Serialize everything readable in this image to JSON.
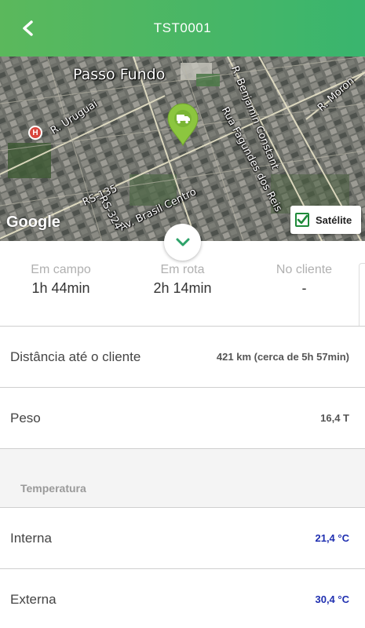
{
  "header": {
    "title": "TST0001",
    "back_icon": "chevron-left-icon"
  },
  "map": {
    "city": "Passo Fundo",
    "roads": {
      "uruguai": "R. Uruguai",
      "brasil": "Av. Brasil Centro",
      "benjamin": "R. Benjamin Constant",
      "fagundes": "Rua Fagundes dos Reis",
      "moron": "R. Moron",
      "rs135": "RS-135",
      "rs324": "RS-324"
    },
    "hospital_icon_text": "H",
    "google_logo": "Google",
    "satellite_label": "Satélite",
    "satellite_checked": true
  },
  "stats": [
    {
      "label": "Em campo",
      "value": "1h 44min"
    },
    {
      "label": "Em rota",
      "value": "2h 14min"
    },
    {
      "label": "No cliente",
      "value": "-"
    }
  ],
  "details": {
    "distance": {
      "label": "Distância até o cliente",
      "value": "421 km (cerca de 5h 57min)"
    },
    "weight": {
      "label": "Peso",
      "value": "16,4 T"
    },
    "temperature_section": "Temperatura",
    "internal": {
      "label": "Interna",
      "value": "21,4 °C"
    },
    "external": {
      "label": "Externa",
      "value": "30,4 °C"
    }
  },
  "colors": {
    "header_start": "#5bb85c",
    "header_end": "#39b56e",
    "marker": "#8cc63f",
    "temperature_value": "#1f2fb0"
  }
}
